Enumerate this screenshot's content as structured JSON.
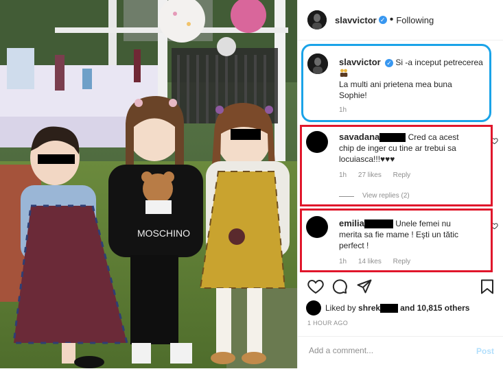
{
  "post": {
    "author": "slavvictor",
    "follow_status": "Following",
    "caption": {
      "line1": "Si -a inceput petrecerea",
      "line2": "La multi ani prietena mea buna",
      "line3": "Sophie!",
      "time": "1h"
    }
  },
  "comments": [
    {
      "user": "savadana",
      "line1": "Cred ca acest",
      "line2": "chip de inger cu tine ar trebui sa",
      "line3": "locuiasca!!!♥♥♥",
      "time": "1h",
      "likes": "27 likes",
      "reply": "Reply",
      "view_replies": "View replies (2)"
    },
    {
      "user": "emilia",
      "line1": "Unele femei nu",
      "line2": "merita sa fie mame ! Eşti un tătic",
      "line3": "perfect !",
      "time": "1h",
      "likes": "14 likes",
      "reply": "Reply"
    }
  ],
  "likes": {
    "prefix": "Liked by",
    "user": "shrek",
    "suffix": "and 10,815 others"
  },
  "timestamp": "1 HOUR AGO",
  "add_comment": {
    "placeholder": "Add a comment...",
    "post_label": "Post"
  },
  "colors": {
    "verified": "#3897f0",
    "annotation_blue": "#1aa3e8",
    "annotation_red": "#e0162b",
    "post_disabled": "#b2dffc"
  },
  "icons": [
    "heart-icon",
    "comment-icon",
    "share-icon",
    "bookmark-icon",
    "verified-icon"
  ]
}
